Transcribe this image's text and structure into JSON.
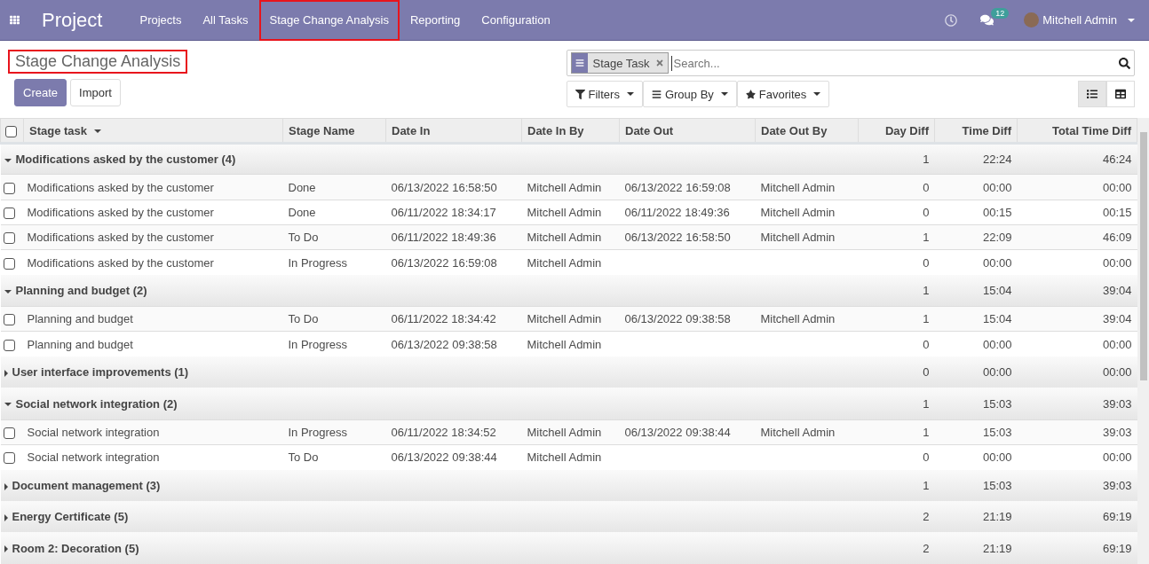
{
  "navbar": {
    "app": "Project",
    "menu": [
      {
        "label": "Projects",
        "highlighted": false
      },
      {
        "label": "All Tasks",
        "highlighted": false
      },
      {
        "label": "Stage Change Analysis",
        "highlighted": true
      },
      {
        "label": "Reporting",
        "highlighted": false
      },
      {
        "label": "Configuration",
        "highlighted": false
      }
    ],
    "message_count": "12",
    "user": "Mitchell Admin"
  },
  "title": {
    "text": "Stage Change Analysis",
    "highlighted": true
  },
  "buttons": [
    "Create",
    "Import"
  ],
  "search": {
    "facet": "Stage Task",
    "placeholder": "Search..."
  },
  "search_options": [
    "Filters",
    "Group By",
    "Favorites"
  ],
  "views": [
    {
      "kind": "list",
      "selected": true
    },
    {
      "kind": "pivot",
      "selected": false
    }
  ],
  "table": {
    "all_checked": false,
    "columns": [
      "Stage task",
      "Stage Name",
      "Date In",
      "Date In By",
      "Date Out",
      "Date Out By",
      "Day Diff",
      "Time Diff",
      "Total Time Diff"
    ],
    "groups": [
      {
        "label": "Modifications asked by the customer (4)",
        "expanded": true,
        "day_diff": "1",
        "time_diff": "22:24",
        "total_time_diff": "46:24",
        "rows": [
          {
            "checked": false,
            "cells": [
              "Modifications asked by the customer",
              "Done",
              "06/13/2022 16:58:50",
              "Mitchell Admin",
              "06/13/2022 16:59:08",
              "Mitchell Admin",
              "0",
              "00:00",
              "00:00"
            ]
          },
          {
            "checked": false,
            "cells": [
              "Modifications asked by the customer",
              "Done",
              "06/11/2022 18:34:17",
              "Mitchell Admin",
              "06/11/2022 18:49:36",
              "Mitchell Admin",
              "0",
              "00:15",
              "00:15"
            ]
          },
          {
            "checked": false,
            "cells": [
              "Modifications asked by the customer",
              "To Do",
              "06/11/2022 18:49:36",
              "Mitchell Admin",
              "06/13/2022 16:58:50",
              "Mitchell Admin",
              "1",
              "22:09",
              "46:09"
            ]
          },
          {
            "checked": false,
            "cells": [
              "Modifications asked by the customer",
              "In Progress",
              "06/13/2022 16:59:08",
              "Mitchell Admin",
              "",
              "",
              "0",
              "00:00",
              "00:00"
            ]
          }
        ]
      },
      {
        "label": "Planning and budget (2)",
        "expanded": true,
        "day_diff": "1",
        "time_diff": "15:04",
        "total_time_diff": "39:04",
        "rows": [
          {
            "checked": false,
            "cells": [
              "Planning and budget",
              "To Do",
              "06/11/2022 18:34:42",
              "Mitchell Admin",
              "06/13/2022 09:38:58",
              "Mitchell Admin",
              "1",
              "15:04",
              "39:04"
            ]
          },
          {
            "checked": false,
            "cells": [
              "Planning and budget",
              "In Progress",
              "06/13/2022 09:38:58",
              "Mitchell Admin",
              "",
              "",
              "0",
              "00:00",
              "00:00"
            ]
          }
        ]
      },
      {
        "label": "User interface improvements (1)",
        "expanded": false,
        "day_diff": "0",
        "time_diff": "00:00",
        "total_time_diff": "00:00"
      },
      {
        "label": "Social network integration (2)",
        "expanded": true,
        "day_diff": "1",
        "time_diff": "15:03",
        "total_time_diff": "39:03",
        "rows": [
          {
            "checked": false,
            "cells": [
              "Social network integration",
              "In Progress",
              "06/11/2022 18:34:52",
              "Mitchell Admin",
              "06/13/2022 09:38:44",
              "Mitchell Admin",
              "1",
              "15:03",
              "39:03"
            ]
          },
          {
            "checked": false,
            "cells": [
              "Social network integration",
              "To Do",
              "06/13/2022 09:38:44",
              "Mitchell Admin",
              "",
              "",
              "0",
              "00:00",
              "00:00"
            ]
          }
        ]
      },
      {
        "label": "Document management (3)",
        "expanded": false,
        "day_diff": "1",
        "time_diff": "15:03",
        "total_time_diff": "39:03"
      },
      {
        "label": "Energy Certificate (5)",
        "expanded": false,
        "day_diff": "2",
        "time_diff": "21:19",
        "total_time_diff": "69:19"
      },
      {
        "label": "Room 2: Decoration (5)",
        "expanded": false,
        "day_diff": "2",
        "time_diff": "21:19",
        "total_time_diff": "69:19"
      }
    ]
  }
}
